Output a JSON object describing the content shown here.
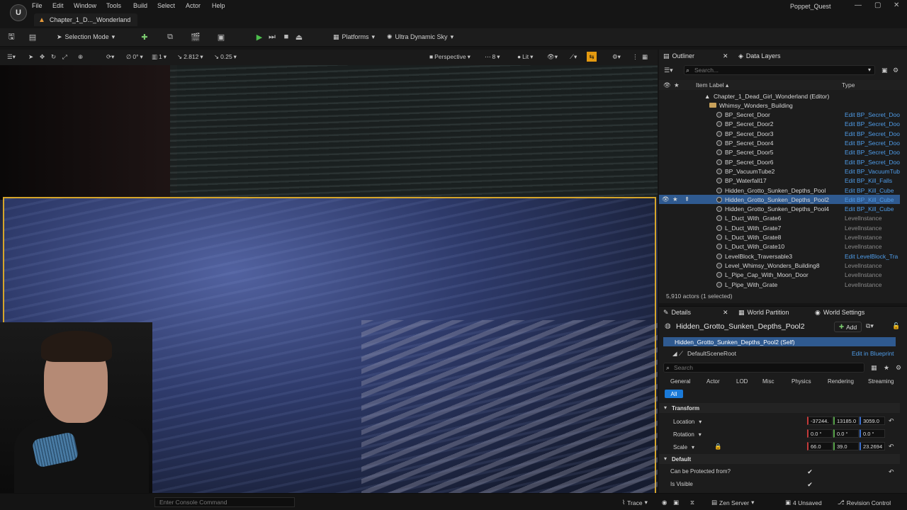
{
  "app": {
    "project_name": "Poppet_Quest",
    "level_tab": "Chapter_1_D..._Wonderland",
    "menu": [
      "File",
      "Edit",
      "Window",
      "Tools",
      "Build",
      "Select",
      "Actor",
      "Help"
    ]
  },
  "toolbar": {
    "selection_mode": "Selection Mode",
    "platforms": "Platforms",
    "sky": "Ultra Dynamic Sky"
  },
  "viewport_toolbar": {
    "rotation_snap": "0°",
    "scale_steps": "1",
    "camera_speed": "2.812",
    "grid_snap": "0.25",
    "perspective": "Perspective",
    "fov": "8",
    "view_mode": "Lit"
  },
  "outliner": {
    "tab": "Outliner",
    "tab2": "Data Layers",
    "search_placeholder": "Search...",
    "col_label": "Item Label ▴",
    "col_type": "Type",
    "root": "Chapter_1_Dead_Girl_Wonderland (Editor)",
    "folder": "Whimsy_Wonders_Building",
    "rows": [
      {
        "label": "BP_Secret_Door",
        "type": "Edit BP_Secret_Door"
      },
      {
        "label": "BP_Secret_Door2",
        "type": "Edit BP_Secret_Door"
      },
      {
        "label": "BP_Secret_Door3",
        "type": "Edit BP_Secret_Door"
      },
      {
        "label": "BP_Secret_Door4",
        "type": "Edit BP_Secret_Door"
      },
      {
        "label": "BP_Secret_Door5",
        "type": "Edit BP_Secret_Door"
      },
      {
        "label": "BP_Secret_Door6",
        "type": "Edit BP_Secret_Door"
      },
      {
        "label": "BP_VacuumTube2",
        "type": "Edit BP_VacuumTub"
      },
      {
        "label": "BP_Waterfall17",
        "type": "Edit BP_Kill_Falls"
      },
      {
        "label": "Hidden_Grotto_Sunken_Depths_Pool",
        "type": "Edit BP_Kill_Cube"
      },
      {
        "label": "Hidden_Grotto_Sunken_Depths_Pool2",
        "type": "Edit BP_Kill_Cube"
      },
      {
        "label": "Hidden_Grotto_Sunken_Depths_Pool4",
        "type": "Edit BP_Kill_Cube"
      },
      {
        "label": "L_Duct_With_Grate6",
        "type": "LevelInstance"
      },
      {
        "label": "L_Duct_With_Grate7",
        "type": "LevelInstance"
      },
      {
        "label": "L_Duct_With_Grate8",
        "type": "LevelInstance"
      },
      {
        "label": "L_Duct_With_Grate10",
        "type": "LevelInstance"
      },
      {
        "label": "LevelBlock_Traversable3",
        "type": "Edit LevelBlock_Tra"
      },
      {
        "label": "Level_Whimsy_Wonders_Building8",
        "type": "LevelInstance"
      },
      {
        "label": "L_Pipe_Cap_With_Moon_Door",
        "type": "LevelInstance"
      },
      {
        "label": "L_Pipe_With_Grate",
        "type": "LevelInstance"
      }
    ],
    "actor_count": "5,910 actors (1 selected)"
  },
  "details": {
    "tab": "Details",
    "tab2": "World Partition",
    "tab3": "World Settings",
    "actor_name": "Hidden_Grotto_Sunken_Depths_Pool2",
    "add_label": "Add",
    "self_row": "Hidden_Grotto_Sunken_Depths_Pool2 (Self)",
    "root_component": "DefaultSceneRoot",
    "edit_in_blueprint": "Edit in Blueprint",
    "search_placeholder": "Search",
    "filters": [
      "General",
      "Actor",
      "LOD",
      "Misc",
      "Physics",
      "Rendering",
      "Streaming"
    ],
    "all_label": "All",
    "transform_header": "Transform",
    "location_label": "Location",
    "location": [
      "-37244.",
      "13185.0",
      "3059.0"
    ],
    "rotation_label": "Rotation",
    "rotation": [
      "0.0 °",
      "0.0 °",
      "0.0 °"
    ],
    "scale_label": "Scale",
    "scale": [
      "66.0",
      "39.0",
      "23.2694"
    ],
    "default_header": "Default",
    "prop1": "Can be Protected from?",
    "prop2": "Is Visible"
  },
  "statusbar": {
    "console_placeholder": "Enter Console Command",
    "trace": "Trace",
    "zen": "Zen Server",
    "unsaved": "4 Unsaved",
    "revision": "Revision Control"
  }
}
